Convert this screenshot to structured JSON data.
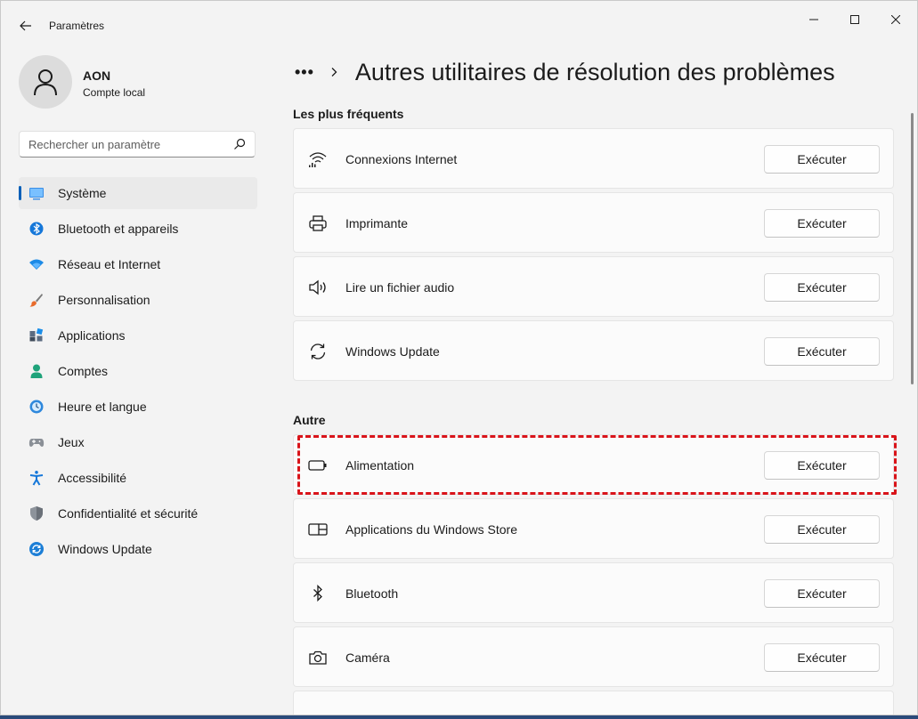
{
  "window": {
    "app_title": "Paramètres"
  },
  "profile": {
    "name": "AON",
    "account_type": "Compte local"
  },
  "search": {
    "placeholder": "Rechercher un paramètre"
  },
  "sidebar": {
    "items": [
      {
        "label": "Système",
        "icon": "system-icon",
        "active": true
      },
      {
        "label": "Bluetooth et appareils",
        "icon": "bluetooth-devices-icon"
      },
      {
        "label": "Réseau et Internet",
        "icon": "network-icon"
      },
      {
        "label": "Personnalisation",
        "icon": "brush-icon"
      },
      {
        "label": "Applications",
        "icon": "apps-icon"
      },
      {
        "label": "Comptes",
        "icon": "accounts-icon"
      },
      {
        "label": "Heure et langue",
        "icon": "time-language-icon"
      },
      {
        "label": "Jeux",
        "icon": "gamepad-icon"
      },
      {
        "label": "Accessibilité",
        "icon": "accessibility-icon"
      },
      {
        "label": "Confidentialité et sécurité",
        "icon": "shield-icon"
      },
      {
        "label": "Windows Update",
        "icon": "windows-update-icon"
      }
    ]
  },
  "breadcrumb": {
    "overflow": "•••",
    "title": "Autres utilitaires de résolution des problèmes"
  },
  "sections": [
    {
      "title": "Les plus fréquents",
      "items": [
        {
          "label": "Connexions Internet",
          "icon": "wifi-icon",
          "button": "Exécuter"
        },
        {
          "label": "Imprimante",
          "icon": "printer-icon",
          "button": "Exécuter"
        },
        {
          "label": "Lire un fichier audio",
          "icon": "speaker-icon",
          "button": "Exécuter"
        },
        {
          "label": "Windows Update",
          "icon": "refresh-icon",
          "button": "Exécuter"
        }
      ]
    },
    {
      "title": "Autre",
      "items": [
        {
          "label": "Alimentation",
          "icon": "battery-icon",
          "button": "Exécuter",
          "highlighted": true
        },
        {
          "label": "Applications du Windows Store",
          "icon": "store-apps-icon",
          "button": "Exécuter"
        },
        {
          "label": "Bluetooth",
          "icon": "bluetooth-icon",
          "button": "Exécuter"
        },
        {
          "label": "Caméra",
          "icon": "camera-icon",
          "button": "Exécuter"
        }
      ]
    }
  ],
  "colors": {
    "accent": "#005fb8",
    "highlight_border": "#d9141a",
    "background": "#f3f3f3"
  }
}
